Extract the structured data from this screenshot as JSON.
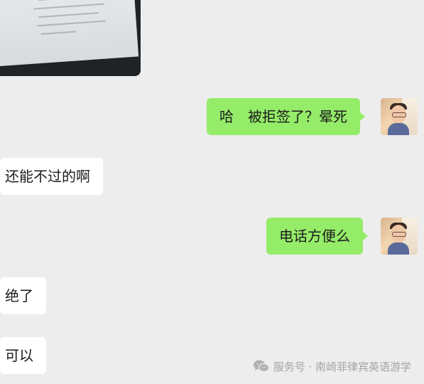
{
  "messages": [
    {
      "side": "right",
      "text": "哈　被拒签了？晕死"
    },
    {
      "side": "left",
      "text": "还能不过的啊"
    },
    {
      "side": "right",
      "text": "电话方便么"
    },
    {
      "side": "left",
      "text": "绝了"
    },
    {
      "side": "left",
      "text": "可以"
    }
  ],
  "watermark": {
    "text": "服务号 · 南崎菲律宾英语游学",
    "icon": "wechat-icon"
  },
  "colors": {
    "background": "#ededed",
    "outgoing_bubble": "#95ec69",
    "incoming_bubble": "#ffffff"
  }
}
